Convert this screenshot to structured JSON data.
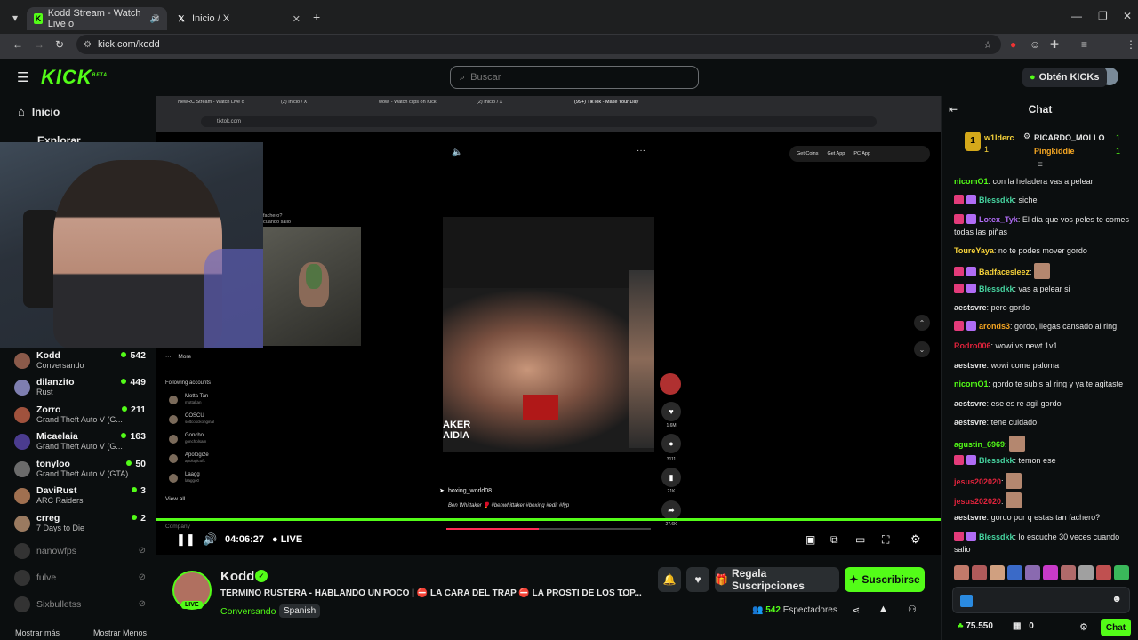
{
  "browser": {
    "tabs": [
      {
        "title": "Kodd Stream - Watch Live o"
      },
      {
        "title": "Inicio / X"
      }
    ],
    "url": "kick.com/kodd"
  },
  "header": {
    "logo": "KICK",
    "logo_beta": "BETA",
    "search_placeholder": "Buscar",
    "get_kicks": "Obtén KICKs"
  },
  "sidebar": {
    "nav": [
      {
        "label": "Inicio"
      },
      {
        "label": "Explorar"
      }
    ],
    "channels": [
      {
        "name": "Kodd",
        "game": "Conversando",
        "viewers": "542",
        "color": "#8b5a4a"
      },
      {
        "name": "dilanzito",
        "game": "Rust",
        "viewers": "449",
        "color": "#7e7eb0"
      },
      {
        "name": "Zorro",
        "game": "Grand Theft Auto V (G...",
        "viewers": "211",
        "color": "#a0523d"
      },
      {
        "name": "Micaelaia",
        "game": "Grand Theft Auto V (G...",
        "viewers": "163",
        "color": "#4b3c8f"
      },
      {
        "name": "tonyloo",
        "game": "Grand Theft Auto V (GTA)",
        "viewers": "50",
        "color": "#6b6b6b"
      },
      {
        "name": "DaviRust",
        "game": "ARC Raiders",
        "viewers": "3",
        "color": "#a07050"
      },
      {
        "name": "crreg",
        "game": "7 Days to Die",
        "viewers": "2",
        "color": "#9a7a60"
      }
    ],
    "offline": [
      {
        "name": "nanowfps"
      },
      {
        "name": "fulve"
      },
      {
        "name": "Sixbulletss"
      }
    ],
    "show_more": "Mostrar más",
    "show_less": "Mostrar Menos"
  },
  "player": {
    "inner_tabs": [
      "NewRC Stream - Watch Live o",
      "(2) Inicio / X",
      "wowi - Watch clips on Kick",
      "(2) Inicio / X",
      "(99+) TikTok - Make Your Day"
    ],
    "inner_url": "tiktok.com",
    "tiktok_top": [
      "Get Coins",
      "Get App",
      "PC App"
    ],
    "tiktok_sidebar": {
      "more": "More",
      "following_title": "Following accounts",
      "accounts": [
        {
          "name": "Motta Tan",
          "sub": "mottaltan"
        },
        {
          "name": "COSCU",
          "sub": "soltcosckonginal"
        },
        {
          "name": "Goncho",
          "sub": "goncholsam"
        },
        {
          "name": "Apologi2e",
          "sub": "apologicofk"
        },
        {
          "name": "Laagg",
          "sub": "laaggo0"
        }
      ],
      "view_all": "View all",
      "company": "Company",
      "fachero_text": "fachero?",
      "fachero_text2": "cuando salio"
    },
    "tiktok_video": {
      "caption_title": "AKER",
      "caption_sub": "AIDIA",
      "author": "boxing_world08",
      "desc": "Ben Whittaker 🥊 #benwhittaker #boxing #edit #fyp",
      "likes": "1.6M",
      "comments": "3111",
      "saves": "21K",
      "shares": "27.6K"
    },
    "time": "04:06:27",
    "live": "LIVE",
    "progress_pct": 100
  },
  "stream": {
    "name": "Kodd",
    "title": "TERMINO RUSTERA - HABLANDO UN POCO | ⛔ LA CARA DEL TRAP ⛔ LA PROSTI DE LOS TOP...",
    "category": "Conversando",
    "language": "Spanish",
    "live_badge": "LIVE",
    "gift_label": "Regala Suscripciones",
    "subscribe_label": "Suscribirse",
    "viewers": "542",
    "viewers_label": "Espectadores"
  },
  "chat": {
    "title": "Chat",
    "top_gifters": [
      {
        "name": "w1lderc",
        "count": "1"
      },
      {
        "name": "RICARDO_MOLLO",
        "count": "1"
      },
      {
        "name": "Pingkiddie",
        "count": "1"
      }
    ],
    "messages": [
      {
        "user": "nicomO1",
        "color": "#53fc18",
        "text": "con la heladera vas a pelear"
      },
      {
        "user": "Blessdkk",
        "color": "#46d4a0",
        "text": "siche"
      },
      {
        "user": "Lotex_Tyk",
        "color": "#b06cf5",
        "text": "El día que vos peles te comes todas las piñas"
      },
      {
        "user": "ToureYaya",
        "color": "#f5d13a",
        "text": "no te podes mover gordo"
      },
      {
        "user": "Badfacesleez",
        "color": "#f5d13a",
        "text": ""
      },
      {
        "user": "Blessdkk",
        "color": "#46d4a0",
        "text": "vas a pelear si"
      },
      {
        "user": "aestsvre",
        "color": "#e4e4e4",
        "text": "pero gordo"
      },
      {
        "user": "aronds3",
        "color": "#f5a623",
        "text": "gordo, llegas cansado al ring"
      },
      {
        "user": "Rodro006",
        "color": "#e0233c",
        "text": "wowi vs newt 1v1"
      },
      {
        "user": "aestsvre",
        "color": "#e4e4e4",
        "text": "wowi come paloma"
      },
      {
        "user": "nicomO1",
        "color": "#53fc18",
        "text": "gordo te subis al ring y ya te agitaste"
      },
      {
        "user": "aestsvre",
        "color": "#e4e4e4",
        "text": "ese es re agil gordo"
      },
      {
        "user": "aestsvre",
        "color": "#e4e4e4",
        "text": "tene cuidado"
      },
      {
        "user": "agustin_6969",
        "color": "#53fc18",
        "text": ""
      },
      {
        "user": "Blessdkk",
        "color": "#46d4a0",
        "text": "temon ese"
      },
      {
        "user": "jesus202020",
        "color": "#e0233c",
        "text": ""
      },
      {
        "user": "jesus202020",
        "color": "#e0233c",
        "text": ""
      },
      {
        "user": "aestsvre",
        "color": "#e4e4e4",
        "text": "gordo por q estas tan fachero?"
      },
      {
        "user": "Blessdkk",
        "color": "#46d4a0",
        "text": "lo escuche 30 veces cuando salio"
      }
    ],
    "balance": "75.550",
    "points": "0",
    "send_label": "Chat"
  }
}
